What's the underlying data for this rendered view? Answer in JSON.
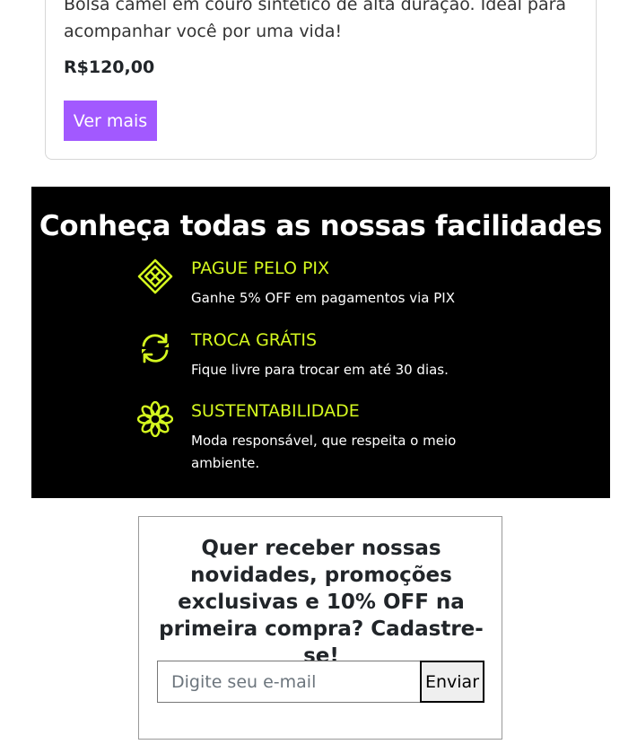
{
  "product": {
    "description": "Bolsa camel em couro sintético de alta duração. Ideal para acompanhar você por uma vida!",
    "price": "R$120,00",
    "button_label": "Ver mais"
  },
  "features": {
    "title": "Conheça todas as nossas facilidades",
    "accent_color": "#d4f71f",
    "items": [
      {
        "icon": "pix-icon",
        "title": "PAGUE PELO PIX",
        "description": "Ganhe 5% OFF em pagamentos via PIX"
      },
      {
        "icon": "exchange-icon",
        "title": "TROCA GRÁTIS",
        "description": "Fique livre para trocar em até 30 dias."
      },
      {
        "icon": "flower-icon",
        "title": "SUSTENTABILIDADE",
        "description": "Moda responsável, que respeita o meio ambiente."
      }
    ]
  },
  "newsletter": {
    "title": "Quer receber nossas novidades, promoções exclusivas e 10% OFF na primeira compra? Cadastre-se!",
    "email_placeholder": "Digite seu e-mail",
    "email_value": "",
    "submit_label": "Enviar"
  },
  "colors": {
    "button_purple": "#a259ff",
    "section_bg": "#000000"
  }
}
